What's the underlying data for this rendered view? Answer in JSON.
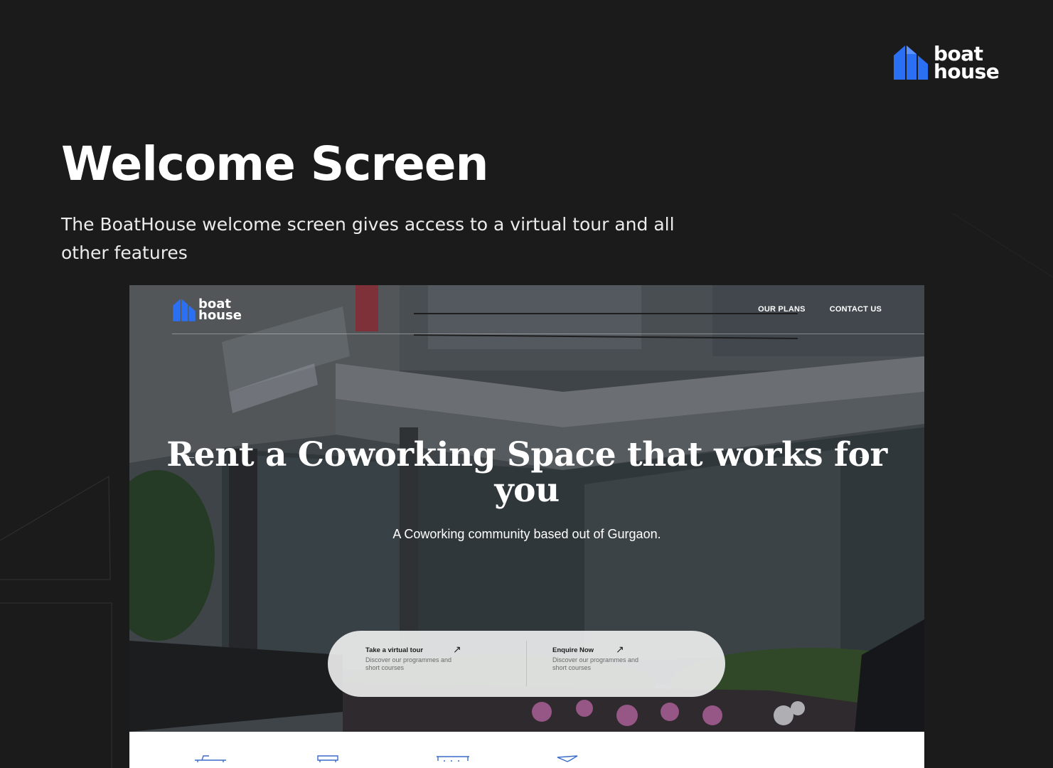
{
  "brand": {
    "line1": "boat",
    "line2": "house",
    "color": "#2b6ff2"
  },
  "page": {
    "title": "Welcome Screen",
    "description": "The BoatHouse welcome screen gives access to a virtual tour and all other features"
  },
  "mockup": {
    "logo": {
      "line1": "boat",
      "line2": "house"
    },
    "nav": {
      "plans": "OUR PLANS",
      "contact": "CONTACT US"
    },
    "arrows": {
      "prev": "←",
      "next": "→"
    },
    "hero": {
      "title": "Rent a Coworking Space that works for you",
      "subtitle": "A Coworking community based out of Gurgaon."
    },
    "cta": [
      {
        "title": "Take a virtual tour",
        "description": "Discover our programmes and short courses",
        "arrow": "↗"
      },
      {
        "title": "Enquire Now",
        "description": "Discover our programmes and short courses",
        "arrow": "↗"
      }
    ],
    "amenities": [
      {
        "icon": "desk-icon"
      },
      {
        "icon": "sofa-icon"
      },
      {
        "icon": "counter-icon"
      },
      {
        "icon": "lamp-icon"
      }
    ]
  }
}
